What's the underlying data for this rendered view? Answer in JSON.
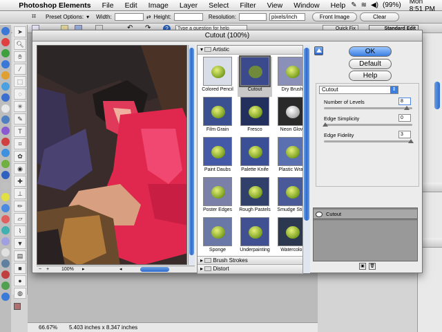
{
  "menubar": {
    "app_name": "Photoshop Elements",
    "items": [
      "File",
      "Edit",
      "Image",
      "Layer",
      "Select",
      "Filter",
      "View",
      "Window",
      "Help"
    ],
    "battery": "(99%)",
    "clock": "Mon 8:51 PM"
  },
  "options": {
    "preset_label": "Preset Options:",
    "width_label": "Width:",
    "height_label": "Height:",
    "resolution_label": "Resolution:",
    "resolution_unit": "pixels/inch",
    "front_image": "Front Image",
    "clear": "Clear"
  },
  "shortcuts": {
    "help_placeholder": "Type a question for help",
    "quick_fix": "Quick Fix",
    "standard_edit": "Standard Edit"
  },
  "document": {
    "zoom": "66.67%",
    "size": "5.403 inches x 8.347 inches"
  },
  "dialog": {
    "title": "Cutout (100%)",
    "preview_zoom": "100%",
    "category_open": "Artistic",
    "filters": [
      "Colored Pencil",
      "Cutout",
      "Dry Brush",
      "Film Grain",
      "Fresco",
      "Neon Glow",
      "Paint Daubs",
      "Palette Knife",
      "Plastic Wrap",
      "Poster Edges",
      "Rough Pastels",
      "Smudge Stick",
      "Sponge",
      "Underpainting",
      "Watercolor"
    ],
    "selected_filter_index": 1,
    "categories_collapsed": [
      "Brush Strokes",
      "Distort"
    ],
    "ok": "OK",
    "default": "Default",
    "help": "Help",
    "filter_select": "Cutout",
    "params": [
      {
        "label": "Number of Levels",
        "value": "8",
        "fraction": 0.95
      },
      {
        "label": "Edge Simplicity",
        "value": "0",
        "fraction": 0.0
      },
      {
        "label": "Edge Fidelity",
        "value": "3",
        "fraction": 1.0
      }
    ],
    "effect_layer": "Cutout"
  }
}
